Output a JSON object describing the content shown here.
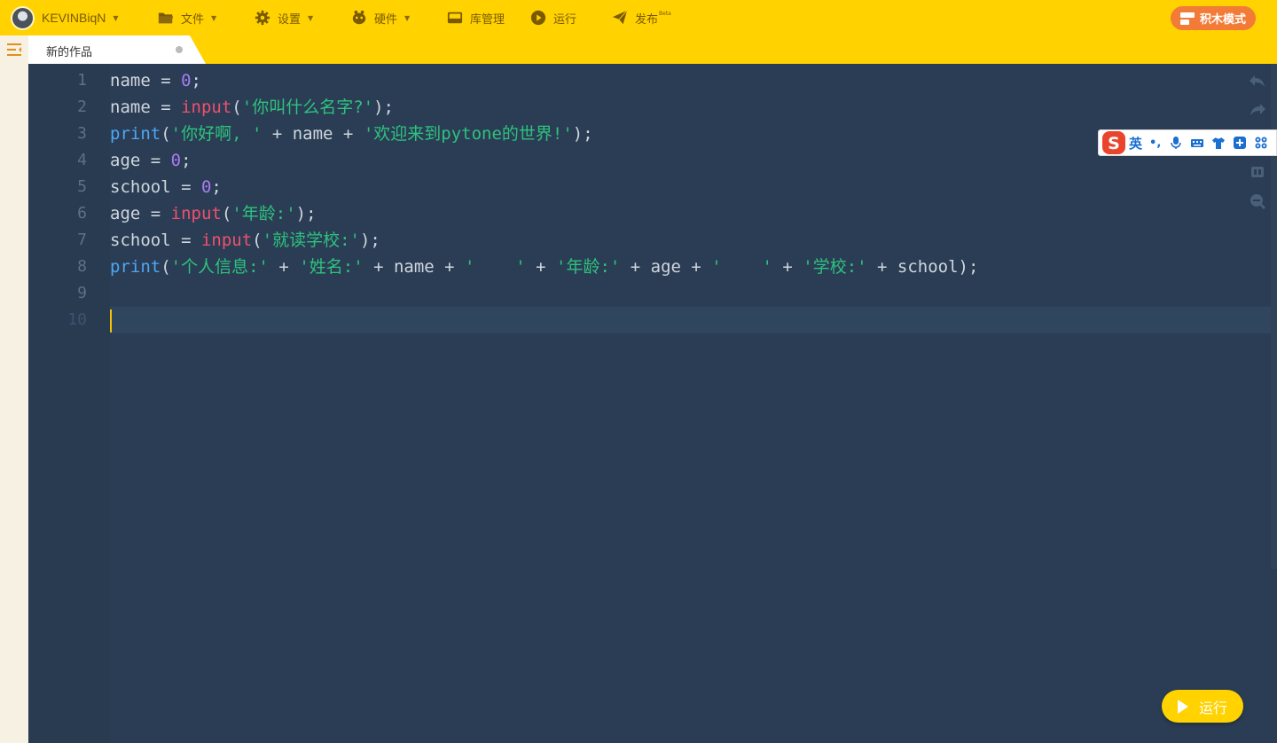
{
  "topbar": {
    "user": {
      "name": "KEVINBiqN",
      "icon": "avatar"
    },
    "menu": [
      {
        "label": "文件",
        "icon": "folder-icon",
        "has_dropdown": true
      },
      {
        "label": "设置",
        "icon": "gear-icon",
        "has_dropdown": true
      },
      {
        "label": "硬件",
        "icon": "robot-icon",
        "has_dropdown": true
      },
      {
        "label": "库管理",
        "icon": "inbox-icon",
        "has_dropdown": false
      },
      {
        "label": "运行",
        "icon": "play-circle-icon",
        "has_dropdown": false
      },
      {
        "label": "发布",
        "badge": "Beta",
        "icon": "paper-plane-icon",
        "has_dropdown": false
      }
    ],
    "blocks_mode": {
      "label": "积木模式",
      "icon": "blocks-icon"
    }
  },
  "tabs": [
    {
      "label": "新的作品",
      "modified_dot": true
    }
  ],
  "editor": {
    "line_numbers": [
      "1",
      "2",
      "3",
      "4",
      "5",
      "6",
      "7",
      "8",
      "9",
      "10"
    ],
    "active_line": "10",
    "lines": [
      [
        [
          "ident",
          "name"
        ],
        [
          "op",
          " = "
        ],
        [
          "num",
          "0"
        ],
        [
          "op",
          ";"
        ]
      ],
      [
        [
          "ident",
          "name"
        ],
        [
          "op",
          " = "
        ],
        [
          "fn",
          "input"
        ],
        [
          "op",
          "("
        ],
        [
          "str",
          "'你叫什么名字?'"
        ],
        [
          "op",
          ");"
        ]
      ],
      [
        [
          "kw",
          "print"
        ],
        [
          "op",
          "("
        ],
        [
          "str",
          "'你好啊, '"
        ],
        [
          "op",
          " + name + "
        ],
        [
          "str",
          "'欢迎来到pytone的世界!'"
        ],
        [
          "op",
          ");"
        ]
      ],
      [
        [
          "ident",
          "age"
        ],
        [
          "op",
          " = "
        ],
        [
          "num",
          "0"
        ],
        [
          "op",
          ";"
        ]
      ],
      [
        [
          "ident",
          "school"
        ],
        [
          "op",
          " = "
        ],
        [
          "num",
          "0"
        ],
        [
          "op",
          ";"
        ]
      ],
      [
        [
          "ident",
          "age"
        ],
        [
          "op",
          " = "
        ],
        [
          "fn",
          "input"
        ],
        [
          "op",
          "("
        ],
        [
          "str",
          "'年龄:'"
        ],
        [
          "op",
          ");"
        ]
      ],
      [
        [
          "ident",
          "school"
        ],
        [
          "op",
          " = "
        ],
        [
          "fn",
          "input"
        ],
        [
          "op",
          "("
        ],
        [
          "str",
          "'就读学校:'"
        ],
        [
          "op",
          ");"
        ]
      ],
      [
        [
          "kw",
          "print"
        ],
        [
          "op",
          "("
        ],
        [
          "str",
          "'个人信息:'"
        ],
        [
          "op",
          " + "
        ],
        [
          "str",
          "'姓名:'"
        ],
        [
          "op",
          " + name + "
        ],
        [
          "str",
          "'    '"
        ],
        [
          "op",
          " + "
        ],
        [
          "str",
          "'年龄:'"
        ],
        [
          "op",
          " + age + "
        ],
        [
          "str",
          "'    '"
        ],
        [
          "op",
          " + "
        ],
        [
          "str",
          "'学校:'"
        ],
        [
          "op",
          " + school);"
        ]
      ],
      [],
      []
    ]
  },
  "tools": [
    "undo-icon",
    "redo-icon",
    "format-icon",
    "zoom-in-icon",
    "zoom-out-icon"
  ],
  "ime": {
    "mode_label": "英",
    "punct": "•,",
    "icons": [
      "mic-icon",
      "keyboard-icon",
      "skin-icon",
      "toolbox-icon",
      "grid-icon"
    ]
  },
  "run_button": {
    "label": "运行"
  },
  "colors": {
    "topbar": "#ffd200",
    "editor_bg": "#2a3d54",
    "keyword": "#4ea7f5",
    "function": "#f0506e",
    "number": "#a77cf2",
    "string": "#2ec27e",
    "blocks_button": "#f27b37"
  }
}
